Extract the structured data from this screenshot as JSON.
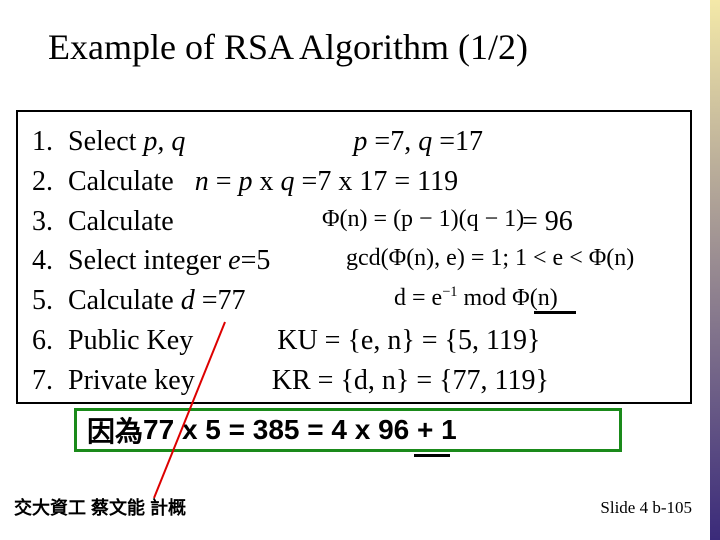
{
  "title": "Example of RSA Algorithm  (1/2)",
  "steps": {
    "n1": "1.",
    "n2": "2.",
    "n3": "3.",
    "n4": "4.",
    "n5": "5.",
    "n6": "6.",
    "n7": "7.",
    "s1a": "Select ",
    "s1b": "p, q",
    "s1c": "                        ",
    "s1d": "p ",
    "s1e": "=7, ",
    "s1f": "q ",
    "s1g": "=17",
    "s2a": "Calculate   ",
    "s2b": "n ",
    "s2c": "= ",
    "s2d": "p ",
    "s2e": "x ",
    "s2f": "q ",
    "s2g": "=7 x 17 = 119",
    "s3a": "Calculate",
    "s3eq": "= 96",
    "phi": "Φ(n) = (p − 1)(q − 1)",
    "s4a": "Select integer ",
    "s4b": "e",
    "s4c": "=5",
    "gcd": "gcd(Φ(n), e) = 1;  1 < e < Φ(n)",
    "s5a": "Calculate ",
    "s5b": "d ",
    "s5c": "=77",
    "dform_a": "d = e",
    "dform_sup": "−1",
    "dform_b": " mod Φ(n)",
    "s6a": "Public Key",
    "s6b": "            KU = {e, n} = {5, 119}",
    "s7a": "Private key",
    "s7b": "           KR = {d, n} = {77, 119}"
  },
  "note_cn": "因為 ",
  "note_eq": "77 x 5 = 385 = 4 x 96 + 1",
  "footer_left": "交大資工 蔡文能 計概",
  "footer_right": "Slide 4 b-105"
}
